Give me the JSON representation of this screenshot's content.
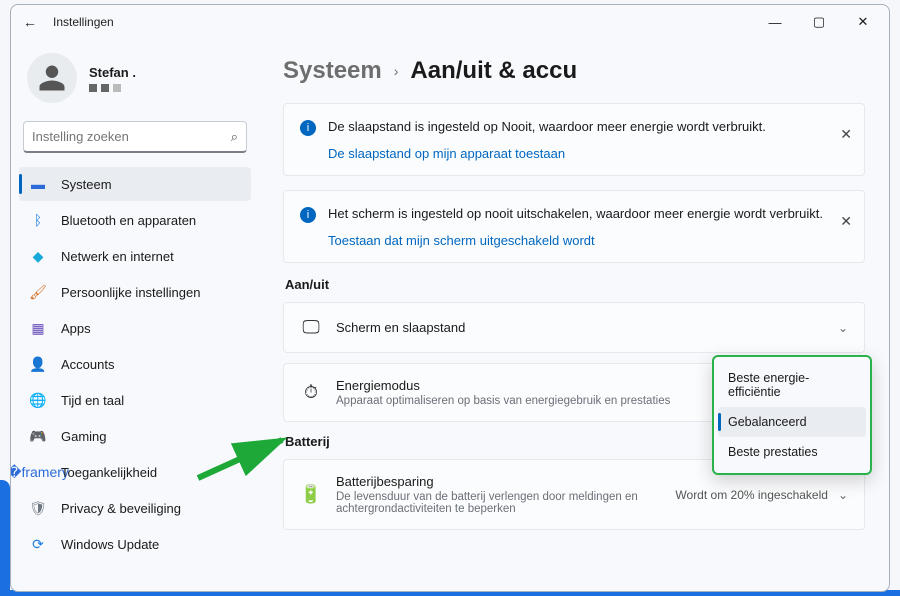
{
  "titlebar": {
    "title": "Instellingen"
  },
  "profile": {
    "name": "Stefan ."
  },
  "search": {
    "placeholder": "Instelling zoeken"
  },
  "sidebar": {
    "items": [
      {
        "label": "Systeem"
      },
      {
        "label": "Bluetooth en apparaten"
      },
      {
        "label": "Netwerk en internet"
      },
      {
        "label": "Persoonlijke instellingen"
      },
      {
        "label": "Apps"
      },
      {
        "label": "Accounts"
      },
      {
        "label": "Tijd en taal"
      },
      {
        "label": "Gaming"
      },
      {
        "label": "Toegankelijkheid"
      },
      {
        "label": "Privacy & beveiliging"
      },
      {
        "label": "Windows Update"
      }
    ]
  },
  "breadcrumb": {
    "parent": "Systeem",
    "current": "Aan/uit & accu"
  },
  "info1": {
    "text": "De slaapstand is ingesteld op Nooit, waardoor meer energie wordt verbruikt.",
    "link": "De slaapstand op mijn apparaat toestaan"
  },
  "info2": {
    "text": "Het scherm is ingesteld op nooit uitschakelen, waardoor meer energie wordt verbruikt.",
    "link": "Toestaan dat mijn scherm uitgeschakeld wordt"
  },
  "sections": {
    "power": "Aan/uit",
    "battery": "Batterij"
  },
  "settings": {
    "screen_sleep": {
      "title": "Scherm en slaapstand"
    },
    "power_mode": {
      "title": "Energiemodus",
      "sub": "Apparaat optimaliseren op basis van energiegebruik en prestaties"
    },
    "battery_saver": {
      "title": "Batterijbesparing",
      "sub": "De levensduur van de batterij verlengen door meldingen en achtergrondactiviteiten te beperken",
      "value": "Wordt om 20% ingeschakeld"
    }
  },
  "dropdown": {
    "opt1": "Beste energie-efficiëntie",
    "opt2": "Gebalanceerd",
    "opt3": "Beste prestaties"
  }
}
